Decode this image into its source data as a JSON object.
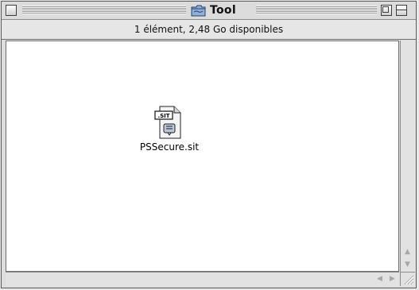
{
  "window": {
    "title": "Tool",
    "title_icon": "folder-icon",
    "controls": [
      "close-box",
      "zoom-box",
      "collapse-box"
    ]
  },
  "status": {
    "text": "1 élément, 2,48 Go disponibles"
  },
  "items": [
    {
      "label": "PSSecure.sit",
      "icon": "stuffit-archive-icon",
      "badge": ".SIT"
    }
  ],
  "colors": {
    "window_bg": "#dedede",
    "content_bg": "#ffffff",
    "border": "#6e6e6e"
  }
}
